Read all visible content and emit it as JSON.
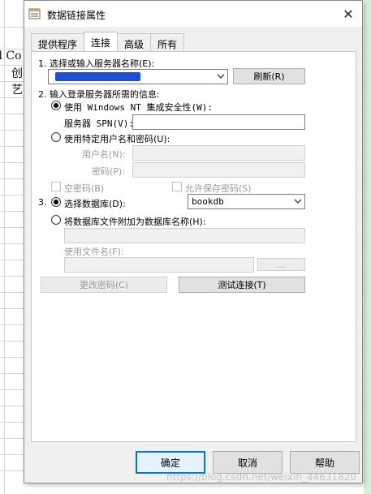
{
  "background": {
    "texts": [
      "d Co",
      "创",
      "艺"
    ]
  },
  "window": {
    "title": "数据链接属性",
    "close_glyph": "✕"
  },
  "tabs": [
    {
      "label": "提供程序"
    },
    {
      "label": "连接"
    },
    {
      "label": "高级"
    },
    {
      "label": "所有"
    }
  ],
  "connection": {
    "step1_label": "1. 选择或输入服务器名称(E):",
    "server_value": "",
    "refresh_label": "刷新(R)",
    "step2_label": "2. 输入登录服务器所需的信息:",
    "radio_nt_label": "使用 Windows NT 集成安全性(W):",
    "spn_label": "服务器 SPN(V):",
    "spn_value": "",
    "radio_user_label": "使用特定用户名和密码(U):",
    "username_label": "用户名(N):",
    "password_label": "密码(P):",
    "blank_pwd_label": "空密码(B)",
    "allow_save_label": "允许保存密码(S)",
    "step3_label": "3.",
    "radio_db_label": "选择数据库(D):",
    "database_value": "bookdb",
    "radio_attach_label": "将数据库文件附加为数据库名称(H):",
    "use_filename_label": "使用文件名(F):",
    "browse_label": "...",
    "change_pwd_label": "更改密码(C)",
    "test_conn_label": "测试连接(T)"
  },
  "footer": {
    "ok": "确定",
    "cancel": "取消",
    "help": "帮助"
  },
  "watermark": "https://blog.csdn.net/weixin_44631820"
}
